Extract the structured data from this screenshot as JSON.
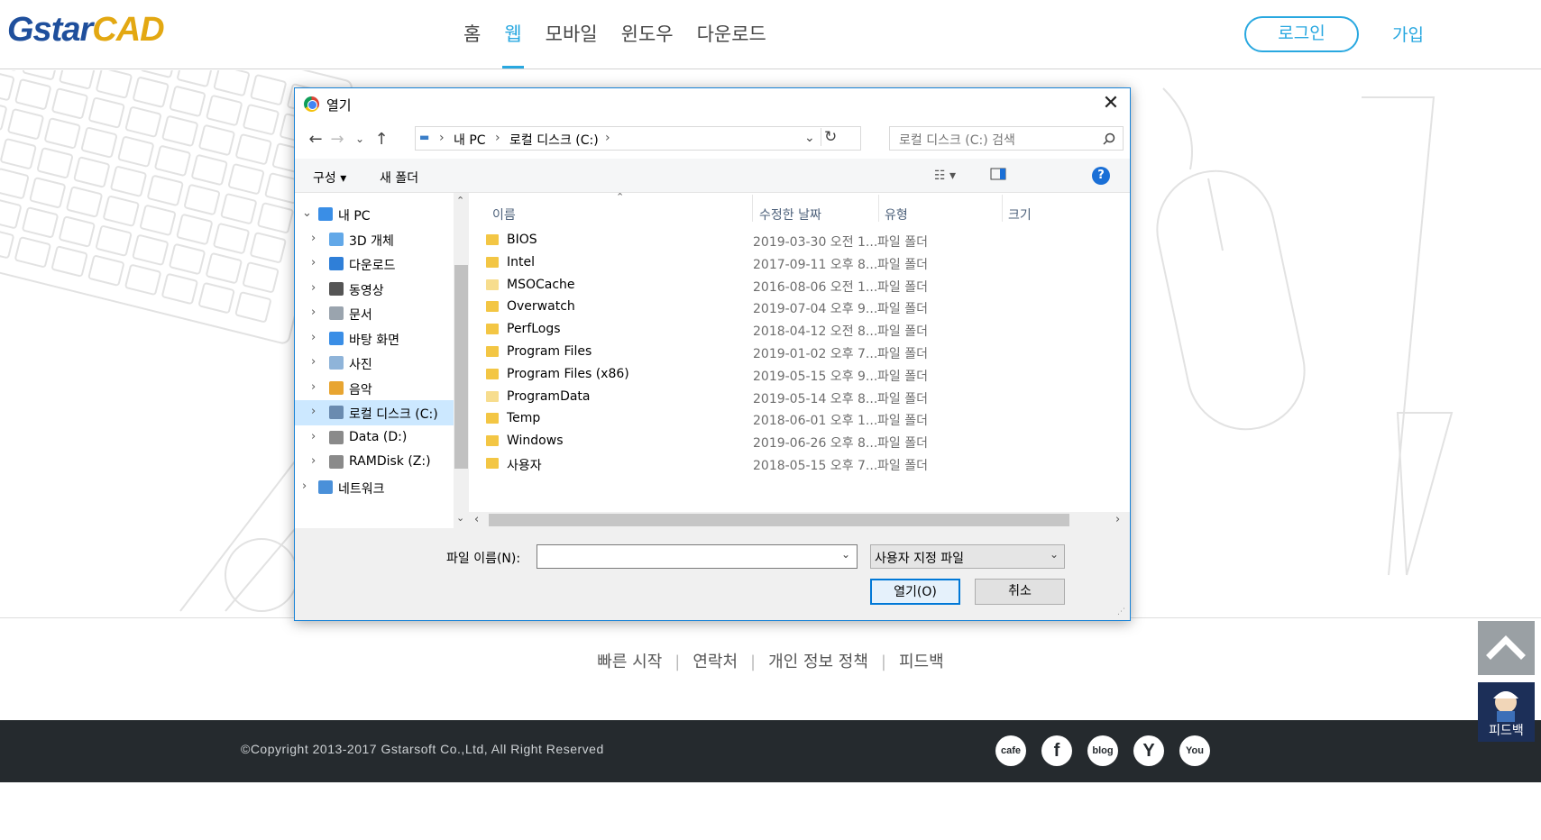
{
  "site": {
    "logo_part1": "Gstar",
    "logo_part2": "CAD",
    "nav": [
      "홈",
      "웹",
      "모바일",
      "윈도우",
      "다운로드"
    ],
    "active_nav": "웹",
    "login": "로그인",
    "signup": "가입",
    "accent_color": "#29a8e0"
  },
  "footer": {
    "links": [
      "빠른 시작",
      "연락처",
      "개인 정보 정책",
      "피드백"
    ],
    "copyright": "©Copyright 2013-2017 Gstarsoft Co.,Ltd, All Right Reserved",
    "social_icons": [
      {
        "name": "cafe-icon",
        "text": "cafe"
      },
      {
        "name": "facebook-icon",
        "text": "f"
      },
      {
        "name": "blog-icon",
        "text": "blog"
      },
      {
        "name": "yahoo-icon",
        "text": "Y"
      },
      {
        "name": "youtube-icon",
        "text": "You"
      }
    ],
    "feedback_float": "피드백"
  },
  "dialog": {
    "title": "열기",
    "close": "✕",
    "breadcrumb": [
      "내 PC",
      "로컬 디스크 (C:)"
    ],
    "search_placeholder": "로컬 디스크 (C:) 검색",
    "toolbar": {
      "organize": "구성",
      "new_folder": "새 폴더",
      "help": "?"
    },
    "nav_tree": [
      {
        "label": "내 PC",
        "icon": "pc-icon",
        "level": 0,
        "expanded": true
      },
      {
        "label": "3D 개체",
        "icon": "3d-objects-icon",
        "level": 1
      },
      {
        "label": "다운로드",
        "icon": "downloads-icon",
        "level": 1
      },
      {
        "label": "동영상",
        "icon": "videos-icon",
        "level": 1
      },
      {
        "label": "문서",
        "icon": "documents-icon",
        "level": 1
      },
      {
        "label": "바탕 화면",
        "icon": "desktop-icon",
        "level": 1
      },
      {
        "label": "사진",
        "icon": "pictures-icon",
        "level": 1
      },
      {
        "label": "음악",
        "icon": "music-icon",
        "level": 1
      },
      {
        "label": "로컬 디스크 (C:)",
        "icon": "drive-c-icon",
        "level": 1,
        "selected": true
      },
      {
        "label": "Data (D:)",
        "icon": "drive-icon",
        "level": 1
      },
      {
        "label": "RAMDisk (Z:)",
        "icon": "drive-icon",
        "level": 1
      },
      {
        "label": "네트워크",
        "icon": "network-icon",
        "level": 0
      }
    ],
    "columns": {
      "name": "이름",
      "date": "수정한 날짜",
      "type": "유형",
      "size": "크기"
    },
    "files": [
      {
        "name": "BIOS",
        "date": "2019-03-30 오전 1...",
        "type": "파일 폴더"
      },
      {
        "name": "Intel",
        "date": "2017-09-11 오후 8...",
        "type": "파일 폴더"
      },
      {
        "name": "MSOCache",
        "date": "2016-08-06 오전 1...",
        "type": "파일 폴더",
        "hidden": true
      },
      {
        "name": "Overwatch",
        "date": "2019-07-04 오후 9...",
        "type": "파일 폴더"
      },
      {
        "name": "PerfLogs",
        "date": "2018-04-12 오전 8...",
        "type": "파일 폴더"
      },
      {
        "name": "Program Files",
        "date": "2019-01-02 오후 7...",
        "type": "파일 폴더"
      },
      {
        "name": "Program Files (x86)",
        "date": "2019-05-15 오후 9...",
        "type": "파일 폴더"
      },
      {
        "name": "ProgramData",
        "date": "2019-05-14 오후 8...",
        "type": "파일 폴더",
        "hidden": true
      },
      {
        "name": "Temp",
        "date": "2018-06-01 오후 1...",
        "type": "파일 폴더"
      },
      {
        "name": "Windows",
        "date": "2019-06-26 오후 8...",
        "type": "파일 폴더"
      },
      {
        "name": "사용자",
        "date": "2018-05-15 오후 7...",
        "type": "파일 폴더"
      }
    ],
    "filename_label": "파일 이름(N):",
    "filename_value": "",
    "filetype_value": "사용자 지정 파일",
    "open_button": "열기(O)",
    "cancel_button": "취소"
  }
}
